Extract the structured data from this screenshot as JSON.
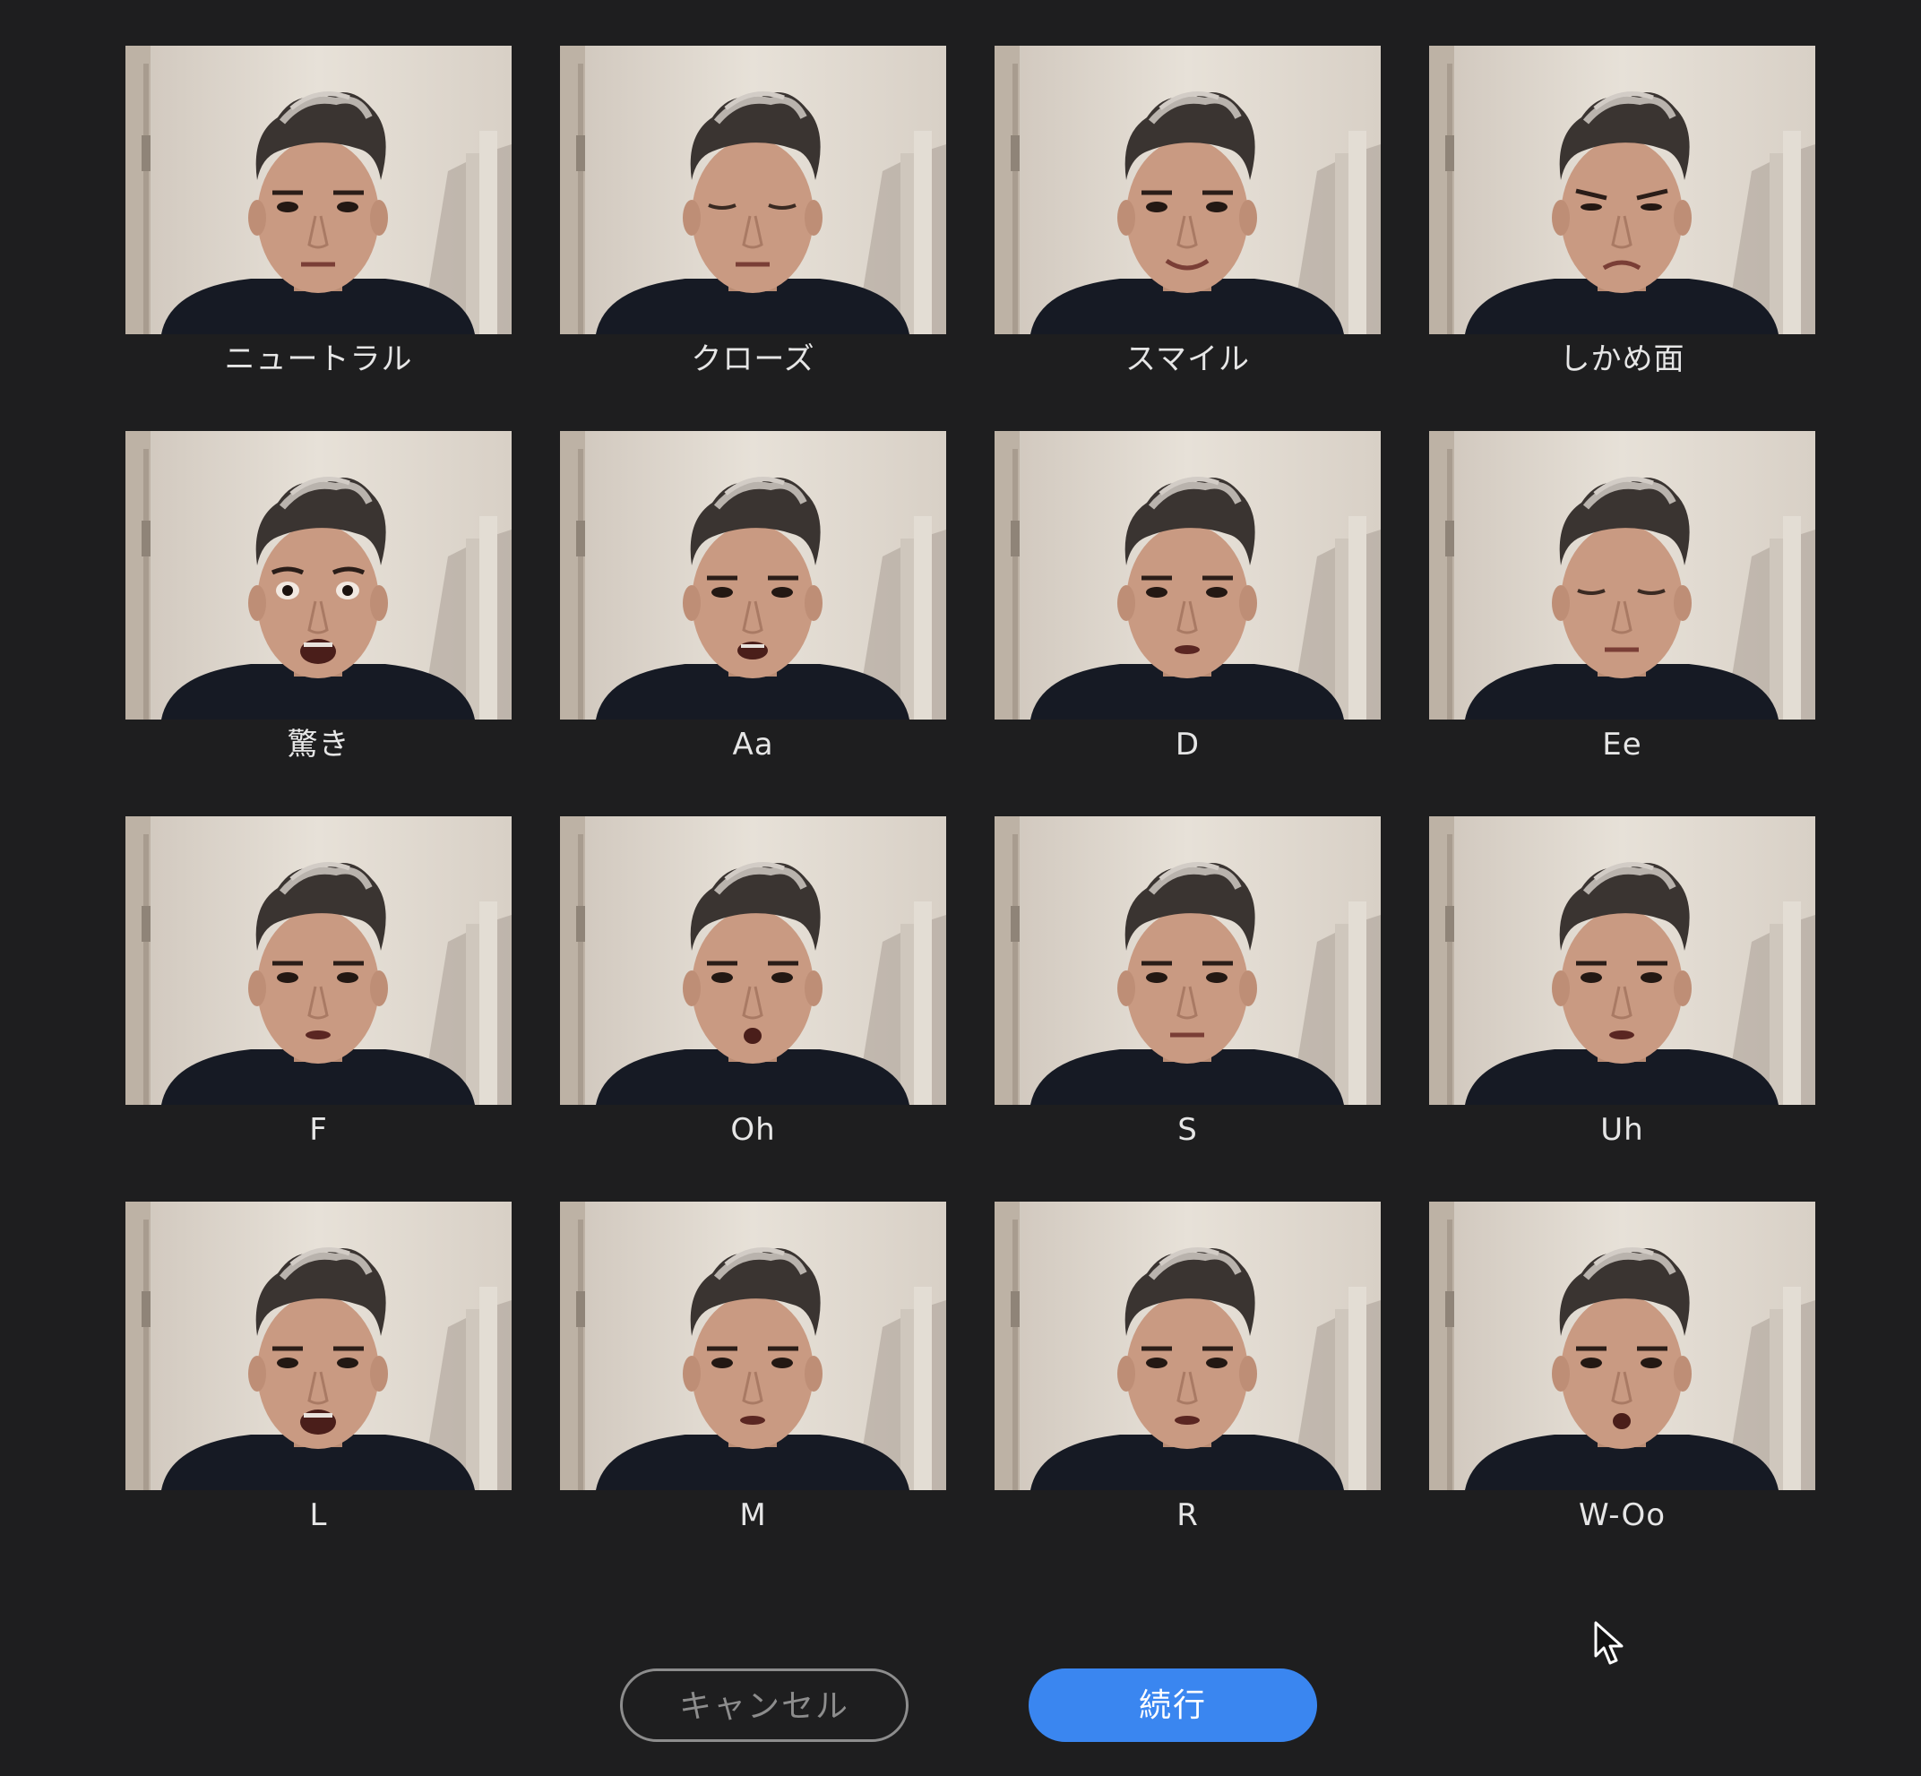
{
  "expressions": [
    {
      "id": "neutral",
      "label": "ニュートラル",
      "mouth": "flat",
      "eyes": "open"
    },
    {
      "id": "closed",
      "label": "クローズ",
      "mouth": "flat",
      "eyes": "closed"
    },
    {
      "id": "smile",
      "label": "スマイル",
      "mouth": "smile",
      "eyes": "open"
    },
    {
      "id": "frown",
      "label": "しかめ面",
      "mouth": "frown",
      "eyes": "squint"
    },
    {
      "id": "surprised",
      "label": "驚き",
      "mouth": "wide",
      "eyes": "wide"
    },
    {
      "id": "aa",
      "label": "Aa",
      "mouth": "open",
      "eyes": "open"
    },
    {
      "id": "d",
      "label": "D",
      "mouth": "small",
      "eyes": "open"
    },
    {
      "id": "ee",
      "label": "Ee",
      "mouth": "flat",
      "eyes": "closed"
    },
    {
      "id": "f",
      "label": "F",
      "mouth": "small",
      "eyes": "open"
    },
    {
      "id": "oh",
      "label": "Oh",
      "mouth": "round",
      "eyes": "open"
    },
    {
      "id": "s",
      "label": "S",
      "mouth": "flat",
      "eyes": "open"
    },
    {
      "id": "uh",
      "label": "Uh",
      "mouth": "small",
      "eyes": "open"
    },
    {
      "id": "l",
      "label": "L",
      "mouth": "wide",
      "eyes": "open"
    },
    {
      "id": "m",
      "label": "M",
      "mouth": "small",
      "eyes": "open"
    },
    {
      "id": "r",
      "label": "R",
      "mouth": "small",
      "eyes": "open"
    },
    {
      "id": "w-oo",
      "label": "W-Oo",
      "mouth": "round",
      "eyes": "open"
    }
  ],
  "buttons": {
    "cancel_label": "キャンセル",
    "continue_label": "続行"
  },
  "colors": {
    "background": "#1e1e1f",
    "accent": "#3a86f0",
    "label_text": "#e6e6e6",
    "cancel_text": "#8d8d8d"
  },
  "icons": {
    "pointer": "mouse-pointer-icon"
  }
}
